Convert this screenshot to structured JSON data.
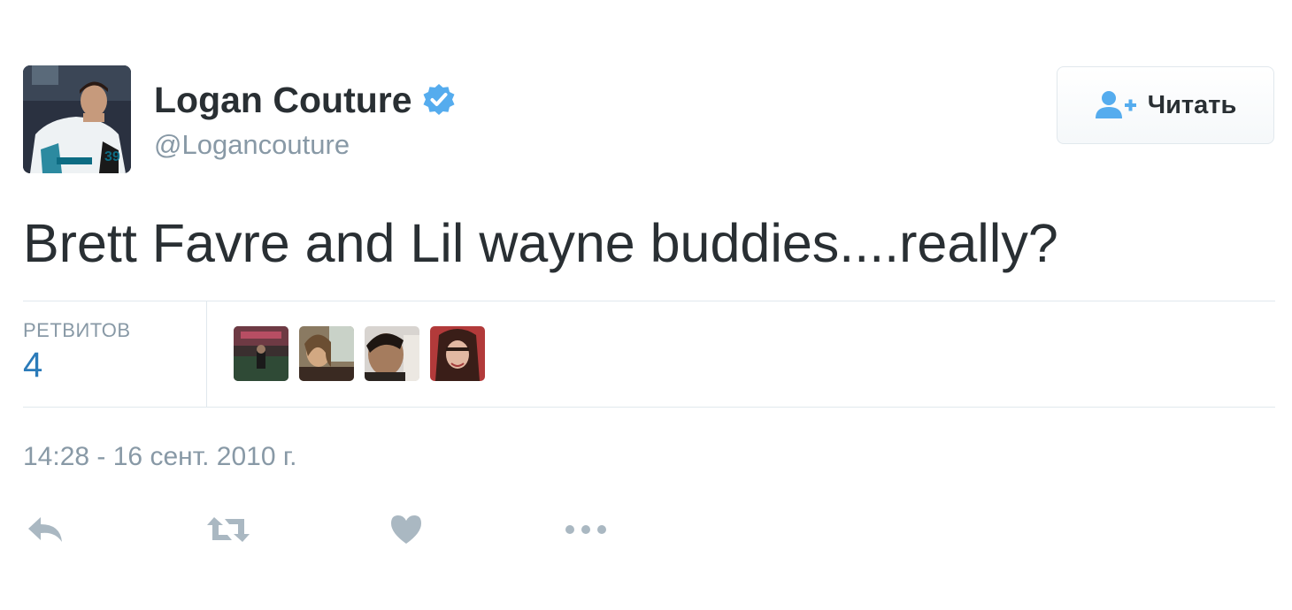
{
  "user": {
    "full_name": "Logan Couture",
    "handle": "@Logancouture",
    "verified": true,
    "avatar_icon": "user-avatar-photo",
    "verified_icon": "verified-badge-icon"
  },
  "follow_button": {
    "label": "Читать",
    "icon": "follow-user-plus-icon"
  },
  "tweet": {
    "text": "Brett Favre and Lil wayne buddies....really?"
  },
  "stats": {
    "retweets_label": "РЕТВИТОВ",
    "retweets_count": "4",
    "retweeter_avatars": [
      "retweeter-avatar-1",
      "retweeter-avatar-2",
      "retweeter-avatar-3",
      "retweeter-avatar-4"
    ]
  },
  "timestamp": "14:28 - 16 сент. 2010 г.",
  "actions": [
    {
      "name": "reply",
      "icon": "reply-icon"
    },
    {
      "name": "retweet",
      "icon": "retweet-icon"
    },
    {
      "name": "like",
      "icon": "heart-icon"
    },
    {
      "name": "more",
      "icon": "more-dots-icon"
    }
  ],
  "colors": {
    "text": "#292f33",
    "muted": "#8899a6",
    "link": "#2b7bb9",
    "verified": "#55acee",
    "border": "#e1e8ed",
    "action_icon": "#aab8c2"
  }
}
